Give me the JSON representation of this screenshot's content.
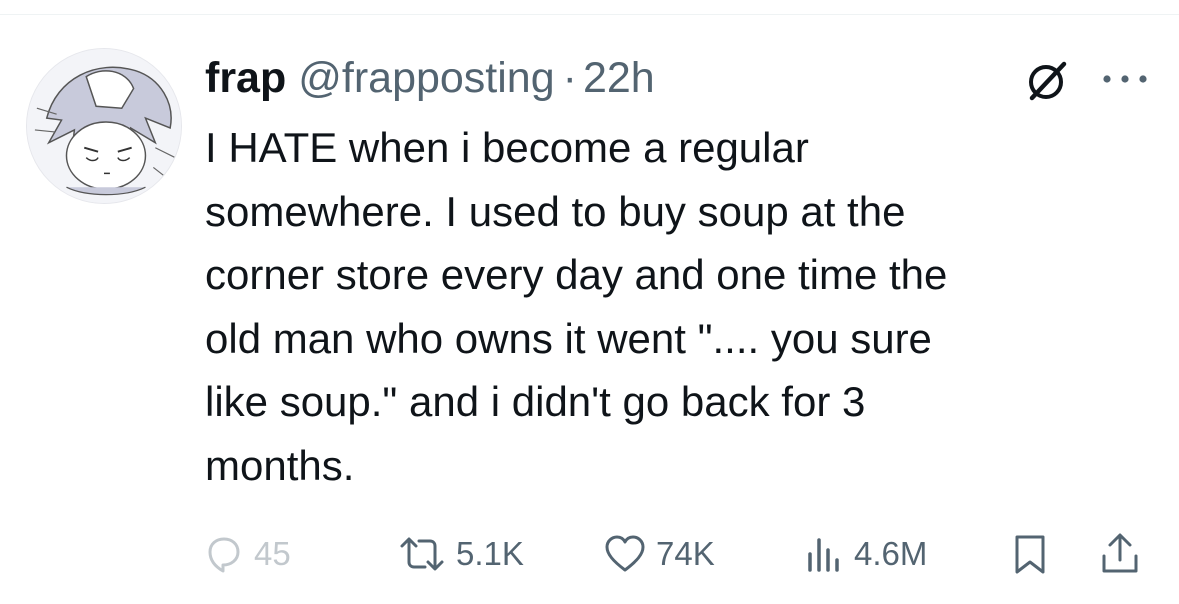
{
  "post": {
    "display_name": "frap",
    "handle": "@frapposting",
    "separator": "·",
    "timestamp": "22h",
    "text": "I HATE when i become a regular\nsomewhere. I used to buy soup at the\ncorner store every day and one time the\nold man who owns it went \".... you sure\nlike soup.\" and i didn't go back for 3\nmonths."
  },
  "metrics": {
    "replies": "45",
    "reposts": "5.1K",
    "likes": "74K",
    "views": "4.6M"
  },
  "icons": {
    "avatar": "anime-character-avatar",
    "grok": "grok-icon",
    "more": "more-dots-icon",
    "reply": "reply-bubble-icon",
    "repost": "repost-icon",
    "like": "heart-icon",
    "views": "bar-chart-icon",
    "bookmark": "bookmark-icon",
    "share": "share-icon"
  },
  "colors": {
    "text": "#0f1419",
    "secondary": "#536471",
    "divider": "#eff3f4"
  }
}
